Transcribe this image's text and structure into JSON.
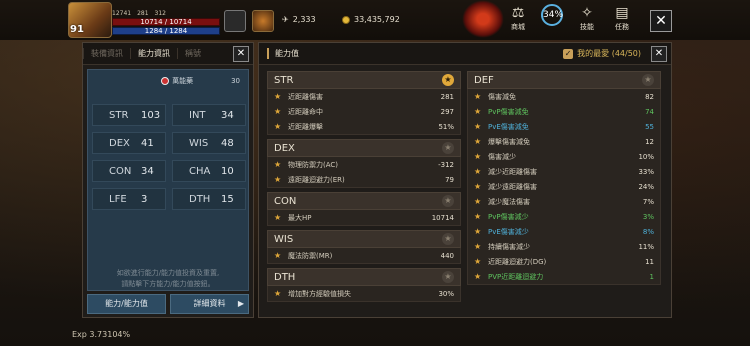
{
  "hud": {
    "level": "91",
    "buff_a": "12741",
    "buff_b": "281",
    "buff_c": "312",
    "hp": "10714 / 10714",
    "mp": "1284 / 1284",
    "wing_value": "2,333",
    "gold_value": "33,435,792",
    "icons": [
      {
        "name": "shop-icon",
        "label": "商城",
        "glyph": "⚖"
      },
      {
        "name": "progress-icon",
        "label": "",
        "glyph": "34%"
      },
      {
        "name": "skill-icon",
        "label": "技能",
        "glyph": "✧"
      },
      {
        "name": "quest-icon",
        "label": "任務",
        "glyph": "▤"
      }
    ]
  },
  "left_panel": {
    "tabs": [
      "裝備資訊",
      "能力資訊",
      "稱號"
    ],
    "active_tab": 1,
    "bonus_label": "萬能藥",
    "bonus_value": "30",
    "stats": [
      {
        "name": "STR",
        "value": "103"
      },
      {
        "name": "INT",
        "value": "34"
      },
      {
        "name": "DEX",
        "value": "41"
      },
      {
        "name": "WIS",
        "value": "48"
      },
      {
        "name": "CON",
        "value": "34"
      },
      {
        "name": "CHA",
        "value": "10"
      },
      {
        "name": "LFE",
        "value": "3"
      },
      {
        "name": "DTH",
        "value": "15"
      }
    ],
    "note_line1": "如欲進行能力/能力值投資及重置,",
    "note_line2": "請點擊下方能力/能力值按鈕。",
    "btn_ability": "能力/能力值",
    "btn_detail": "詳細資料"
  },
  "right_panel": {
    "title": "能力值",
    "fav_label": "我的最愛 (44/50)",
    "left_groups": [
      {
        "name": "STR",
        "starred": true,
        "rows": [
          {
            "name": "近距離傷害",
            "value": "281",
            "color": ""
          },
          {
            "name": "近距離命中",
            "value": "297",
            "color": ""
          },
          {
            "name": "近距離爆擊",
            "value": "51%",
            "color": ""
          }
        ]
      },
      {
        "name": "DEX",
        "starred": false,
        "rows": [
          {
            "name": "物理防禦力(AC)",
            "value": "-312",
            "color": ""
          },
          {
            "name": "遠距離迴避力(ER)",
            "value": "79",
            "color": ""
          }
        ]
      },
      {
        "name": "CON",
        "starred": false,
        "rows": [
          {
            "name": "最大HP",
            "value": "10714",
            "color": ""
          }
        ]
      },
      {
        "name": "WIS",
        "starred": false,
        "rows": [
          {
            "name": "魔法防禦(MR)",
            "value": "440",
            "color": ""
          }
        ]
      },
      {
        "name": "DTH",
        "starred": false,
        "rows": [
          {
            "name": "增加對方經驗值損失",
            "value": "30%",
            "color": ""
          }
        ]
      }
    ],
    "right_groups": [
      {
        "name": "DEF",
        "starred": false,
        "rows": [
          {
            "name": "傷害減免",
            "value": "82",
            "color": ""
          },
          {
            "name": "PvP傷害減免",
            "value": "74",
            "color": "green"
          },
          {
            "name": "PvE傷害減免",
            "value": "55",
            "color": "blue"
          },
          {
            "name": "爆擊傷害減免",
            "value": "12",
            "color": ""
          },
          {
            "name": "傷害減少",
            "value": "10%",
            "color": ""
          },
          {
            "name": "減少近距離傷害",
            "value": "33%",
            "color": ""
          },
          {
            "name": "減少遠距離傷害",
            "value": "24%",
            "color": ""
          },
          {
            "name": "減少魔法傷害",
            "value": "7%",
            "color": ""
          },
          {
            "name": "PvP傷害減少",
            "value": "3%",
            "color": "green"
          },
          {
            "name": "PvE傷害減少",
            "value": "8%",
            "color": "blue"
          },
          {
            "name": "持續傷害減少",
            "value": "11%",
            "color": ""
          },
          {
            "name": "近距離迴避力(DG)",
            "value": "11",
            "color": ""
          },
          {
            "name": "PVP近距離迴避力",
            "value": "1",
            "color": "green"
          }
        ]
      }
    ]
  },
  "exp": "Exp 3.73104%"
}
